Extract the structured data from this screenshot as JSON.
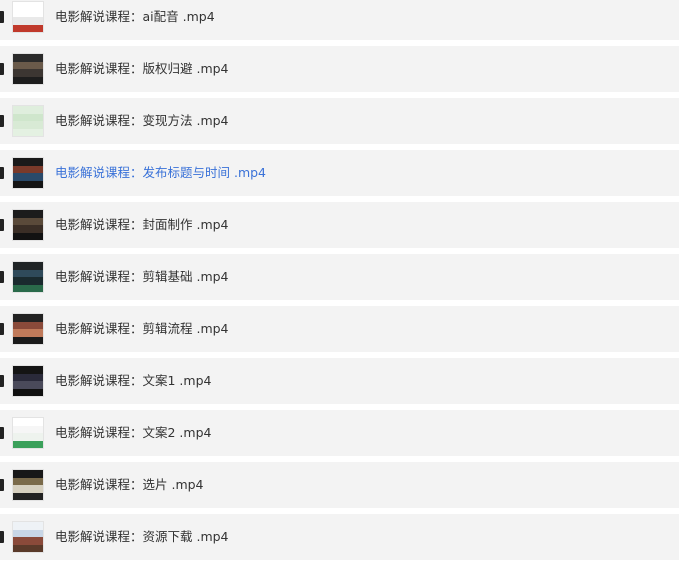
{
  "files": [
    {
      "name": "电影解说课程：ai配音 .mp4",
      "active": false,
      "thumb": [
        "#ffffff",
        "#ffffff",
        "#e9e9e9",
        "#c0392b"
      ]
    },
    {
      "name": "电影解说课程：版权归避 .mp4",
      "active": false,
      "thumb": [
        "#2a2a2a",
        "#6a5a4a",
        "#3c3632",
        "#1d1d1d"
      ]
    },
    {
      "name": "电影解说课程：变现方法 .mp4",
      "active": false,
      "thumb": [
        "#dfeedd",
        "#cfe6cc",
        "#d8ead5",
        "#e4f1e2"
      ]
    },
    {
      "name": "电影解说课程：发布标题与时间 .mp4",
      "active": true,
      "thumb": [
        "#1a1a1a",
        "#7a3a2a",
        "#2a4a6a",
        "#151515"
      ]
    },
    {
      "name": "电影解说课程：封面制作 .mp4",
      "active": false,
      "thumb": [
        "#1c1c1c",
        "#5a4a3a",
        "#3a2e26",
        "#121212"
      ]
    },
    {
      "name": "电影解说课程：剪辑基础 .mp4",
      "active": false,
      "thumb": [
        "#202426",
        "#2f4a5a",
        "#1a2a2e",
        "#2a6a4a"
      ]
    },
    {
      "name": "电影解说课程：剪辑流程 .mp4",
      "active": false,
      "thumb": [
        "#222222",
        "#8a4a3a",
        "#c07a5a",
        "#1a1a1a"
      ]
    },
    {
      "name": "电影解说课程：文案1 .mp4",
      "active": false,
      "thumb": [
        "#141414",
        "#2a2a3a",
        "#4a4a5a",
        "#101010"
      ]
    },
    {
      "name": "电影解说课程：文案2 .mp4",
      "active": false,
      "thumb": [
        "#ffffff",
        "#f6f6f6",
        "#eef3ee",
        "#3aa05a"
      ]
    },
    {
      "name": "电影解说课程：选片 .mp4",
      "active": false,
      "thumb": [
        "#181818",
        "#7a6a4a",
        "#d6d0c0",
        "#222222"
      ]
    },
    {
      "name": "电影解说课程：资源下载 .mp4",
      "active": false,
      "thumb": [
        "#eef2f6",
        "#c8d6e6",
        "#8a4a3a",
        "#5a3a2a"
      ]
    }
  ],
  "colors": {
    "row_bg": "#f3f3f3",
    "text": "#333333",
    "active_text": "#3a72d8",
    "marker": "#222222"
  },
  "icons": {
    "row_marker": "row-marker-icon",
    "thumbnail": "video-thumbnail"
  }
}
